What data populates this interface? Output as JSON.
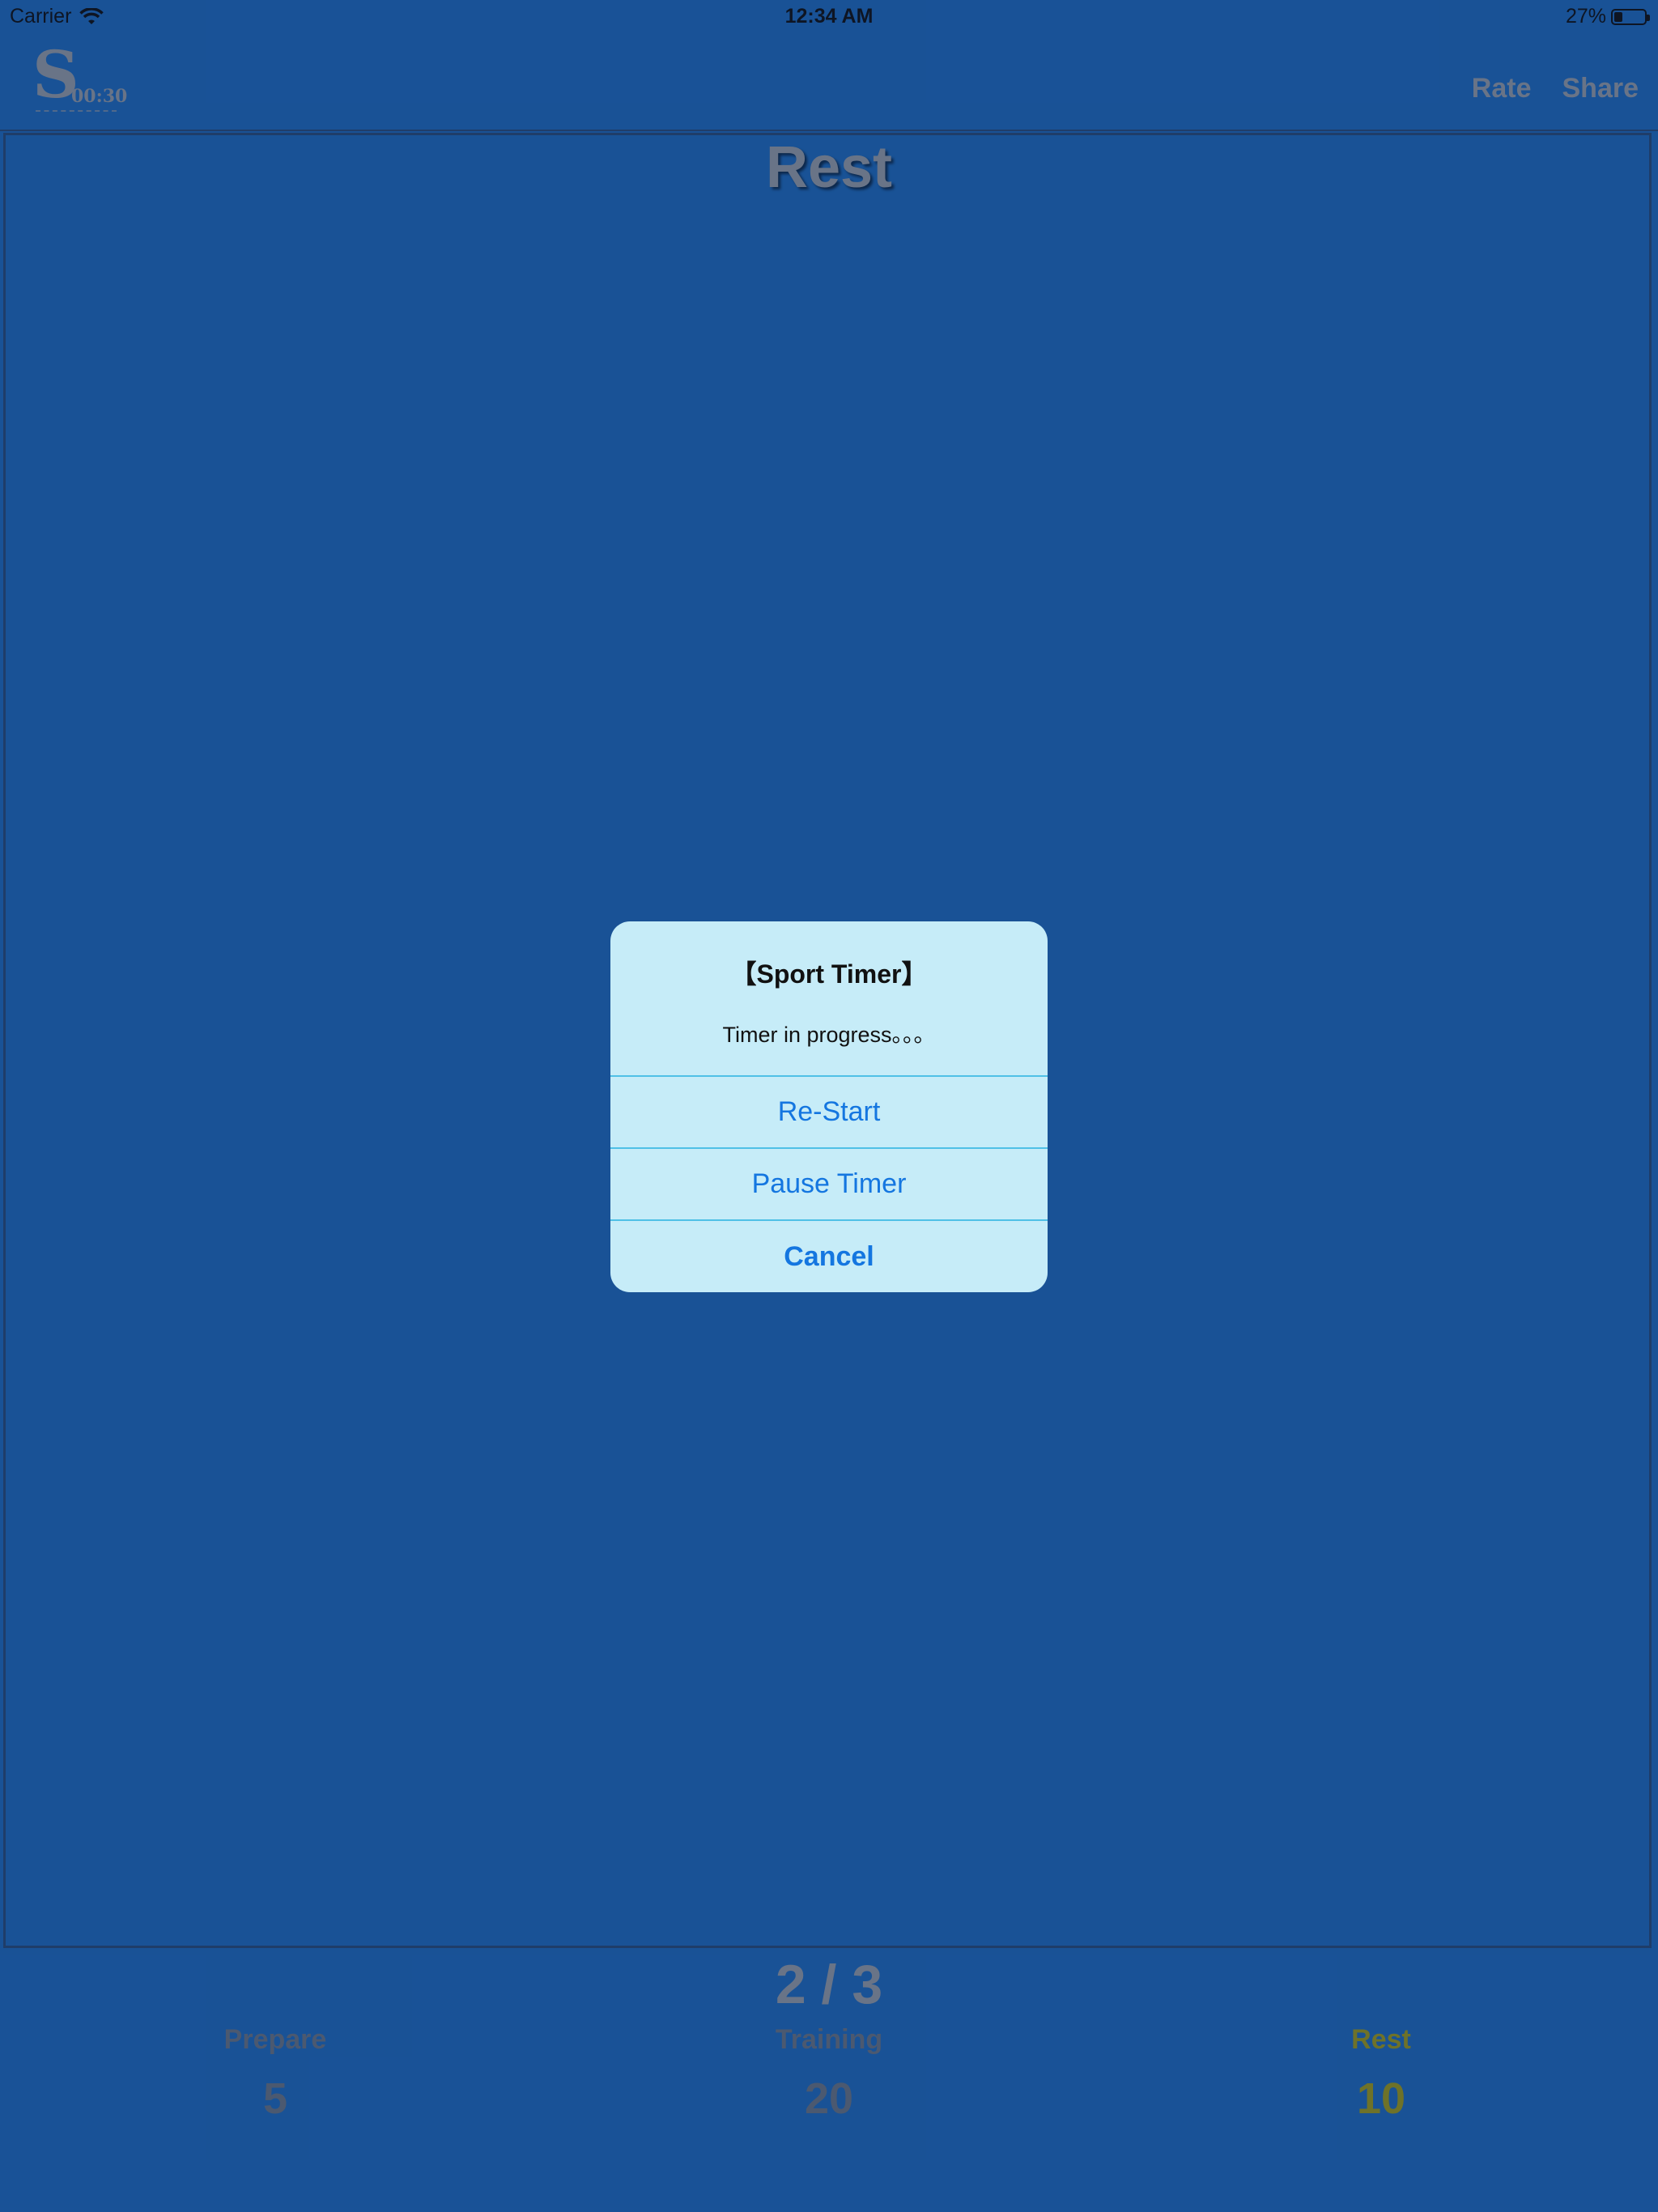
{
  "status_bar": {
    "carrier": "Carrier",
    "time": "12:34 AM",
    "battery_percent": "27%",
    "battery_level": 0.27
  },
  "navbar": {
    "logo_letter": "S",
    "logo_time": "00:30",
    "rate_label": "Rate",
    "share_label": "Share"
  },
  "main": {
    "phase_title": "Rest"
  },
  "bottom": {
    "round_counter": "2 / 3",
    "prepare_label": "Prepare",
    "prepare_value": "5",
    "training_label": "Training",
    "training_value": "20",
    "rest_label": "Rest",
    "rest_value": "10",
    "active_color": "#a7a21a",
    "inactive_color": "#6f7a88"
  },
  "alert": {
    "title": "【Sport Timer】",
    "message": "Timer in progress。。。",
    "restart_label": "Re-Start",
    "pause_label": "Pause Timer",
    "cancel_label": "Cancel",
    "button_color": "#1476e0"
  },
  "icons": {
    "wifi": "wifi-icon",
    "battery": "battery-icon",
    "logo": "app-logo"
  }
}
